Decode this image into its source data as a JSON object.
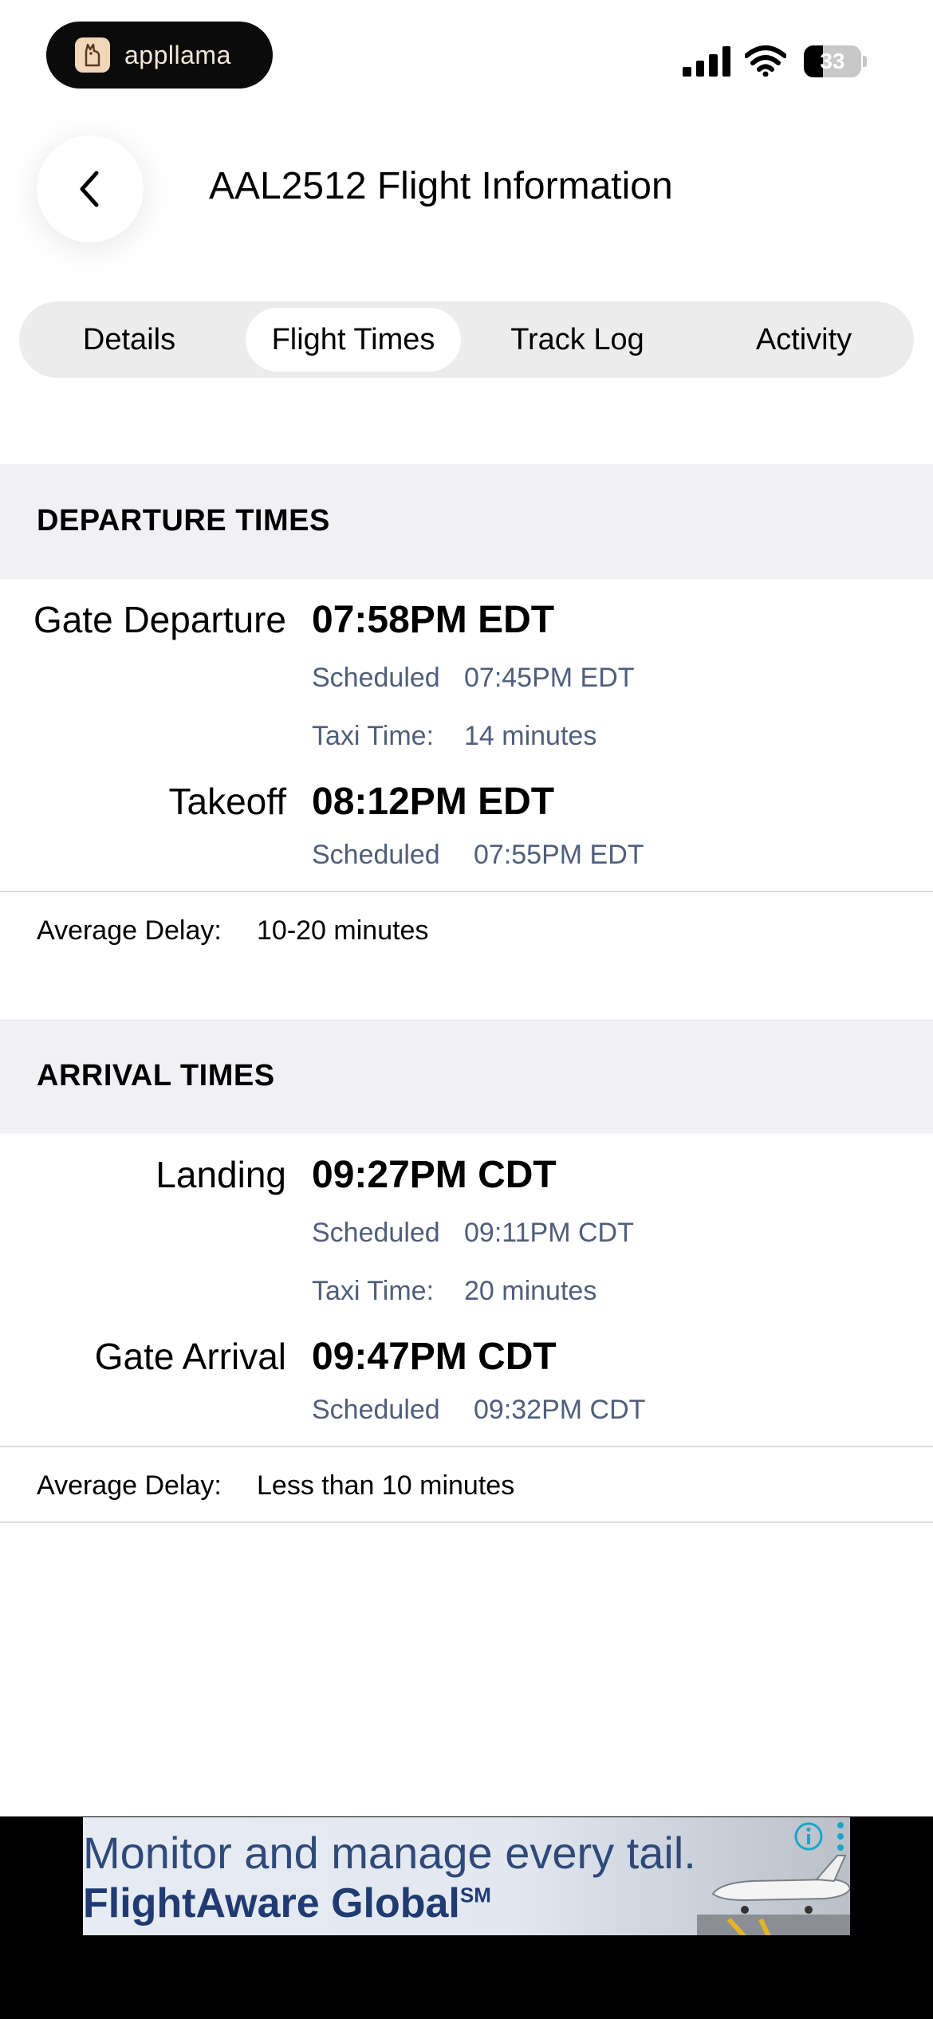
{
  "status_bar": {
    "app_badge": "appllama",
    "battery": "33"
  },
  "header": {
    "title": "AAL2512 Flight Information"
  },
  "tabs": [
    {
      "label": "Details",
      "active": false
    },
    {
      "label": "Flight Times",
      "active": true
    },
    {
      "label": "Track Log",
      "active": false
    },
    {
      "label": "Activity",
      "active": false
    }
  ],
  "departure": {
    "heading": "DEPARTURE TIMES",
    "gate_departure": {
      "label": "Gate Departure",
      "time": "07:58PM EDT",
      "scheduled_label": "Scheduled",
      "scheduled": "07:45PM EDT"
    },
    "taxi": {
      "label": "Taxi Time:",
      "value": "14 minutes"
    },
    "takeoff": {
      "label": "Takeoff",
      "time": "08:12PM EDT",
      "scheduled_label": "Scheduled",
      "scheduled": "07:55PM EDT"
    },
    "average_delay": {
      "label": "Average Delay:",
      "value": "10-20 minutes"
    }
  },
  "arrival": {
    "heading": "ARRIVAL TIMES",
    "landing": {
      "label": "Landing",
      "time": "09:27PM CDT",
      "scheduled_label": "Scheduled",
      "scheduled": "09:11PM CDT"
    },
    "taxi": {
      "label": "Taxi Time:",
      "value": "20 minutes"
    },
    "gate_arrival": {
      "label": "Gate Arrival",
      "time": "09:47PM CDT",
      "scheduled_label": "Scheduled",
      "scheduled": "09:32PM CDT"
    },
    "average_delay": {
      "label": "Average Delay:",
      "value": "Less than 10 minutes"
    }
  },
  "ad": {
    "line1": "Monitor and manage every tail.",
    "line2": "FlightAware Global",
    "line2_mark": "SM"
  },
  "icons": {
    "back": "chevron-left-icon",
    "signal": "cellular-signal-icon",
    "wifi": "wifi-icon",
    "battery": "battery-icon",
    "ad_info": "info-icon",
    "ad_more": "more-vertical-icon"
  },
  "colors": {
    "secondary_text": "#4f5e7a",
    "section_bg": "#f0f0f5",
    "tab_bar_bg": "#ececec"
  }
}
